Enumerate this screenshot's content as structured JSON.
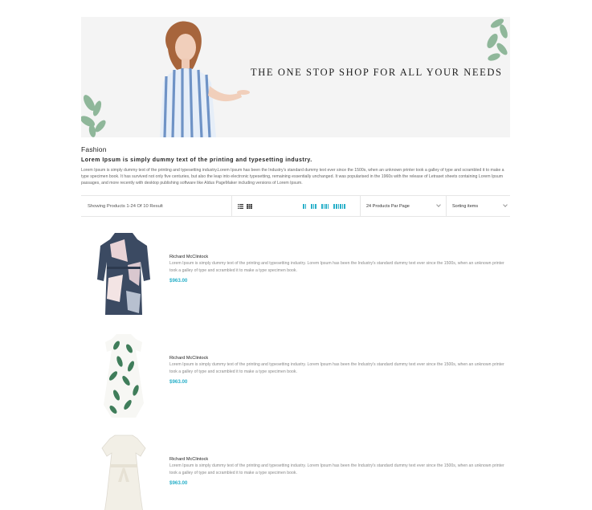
{
  "banner": {
    "tagline": "THE ONE STOP SHOP FOR ALL YOUR NEEDS"
  },
  "category": {
    "title": "Fashion",
    "subtitle": "Lorem Ipsum is simply dummy text of the printing and typesetting industry.",
    "description": "Lorem Ipsum is simply dummy text of the printing and typesetting industry.Lorem Ipsum has been the Industry's standard dummy text ever since the 1500s, when an unknown printer took a galley of type and scrambled it to make a type specimen book. It has survived not only five centuries, but also the leap into electronic typesetting, remaining essentially unchanged. It was popularised in the 1960s with the release of Letraset sheets containing Lorem Ipsum passages, and more recently with desktop publishing software like Aldus PageMaker including versions of Lorem Ipsum."
  },
  "toolbar": {
    "result_text": "Showing Products 1-24 Of 10 Result",
    "per_page": "24 Products Par Page",
    "sort": "Sorting items",
    "accent": "#2ab0c9"
  },
  "products": [
    {
      "brand": "Richard McClintock",
      "description": "Lorem Ipsum is simply dummy text of the printing and typesetting industry. Lorem Ipsum has been the Industry's standard dummy text ever since the 1500s, when an unknown printer took a galley of type and scrambled it to make a type specimen book.",
      "price": "$963.00"
    },
    {
      "brand": "Richard McClintock",
      "description": "Lorem Ipsum is simply dummy text of the printing and typesetting industry. Lorem Ipsum has been the Industry's standard dummy text ever since the 1500s, when an unknown printer took a galley of type and scrambled it to make a type specimen book.",
      "price": "$963.00"
    },
    {
      "brand": "Richard McClintock",
      "description": "Lorem Ipsum is simply dummy text of the printing and typesetting industry. Lorem Ipsum has been the Industry's standard dummy text ever since the 1500s, when an unknown printer took a galley of type and scrambled it to make a type specimen book.",
      "price": "$963.00"
    }
  ]
}
